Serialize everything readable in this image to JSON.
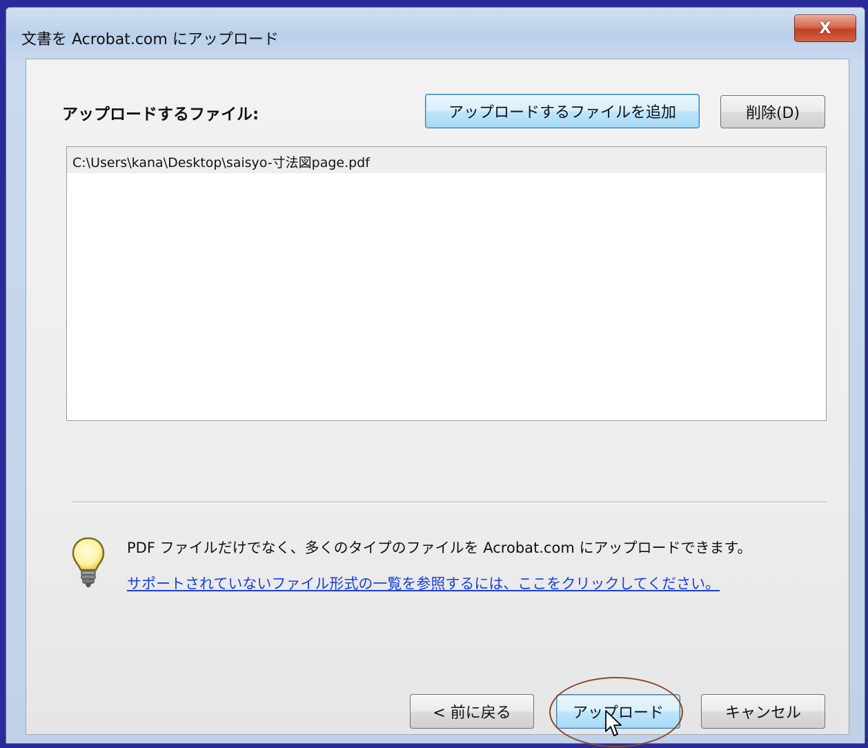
{
  "window": {
    "title": "文書を Acrobat.com にアップロード",
    "close_label": "X"
  },
  "main": {
    "heading": "アップロードするファイル:",
    "add_button": "アップロードするファイルを追加",
    "delete_button": "削除(D)",
    "files": [
      "C:\\Users\\kana\\Desktop\\saisyo-寸法図page.pdf"
    ]
  },
  "info": {
    "text": "PDF ファイルだけでなく、多くのタイプのファイルを Acrobat.com にアップロードできます。",
    "link": "サポートされていないファイル形式の一覧を参照するには、ここをクリックしてください。",
    "icon": "lightbulb-icon"
  },
  "footer": {
    "back_button": "< 前に戻る",
    "upload_button": "アップロード",
    "cancel_button": "キャンセル"
  },
  "colors": {
    "link": "#1a3fd6",
    "close_button": "#c04020",
    "annotation_ellipse": "#8b4a2a"
  }
}
